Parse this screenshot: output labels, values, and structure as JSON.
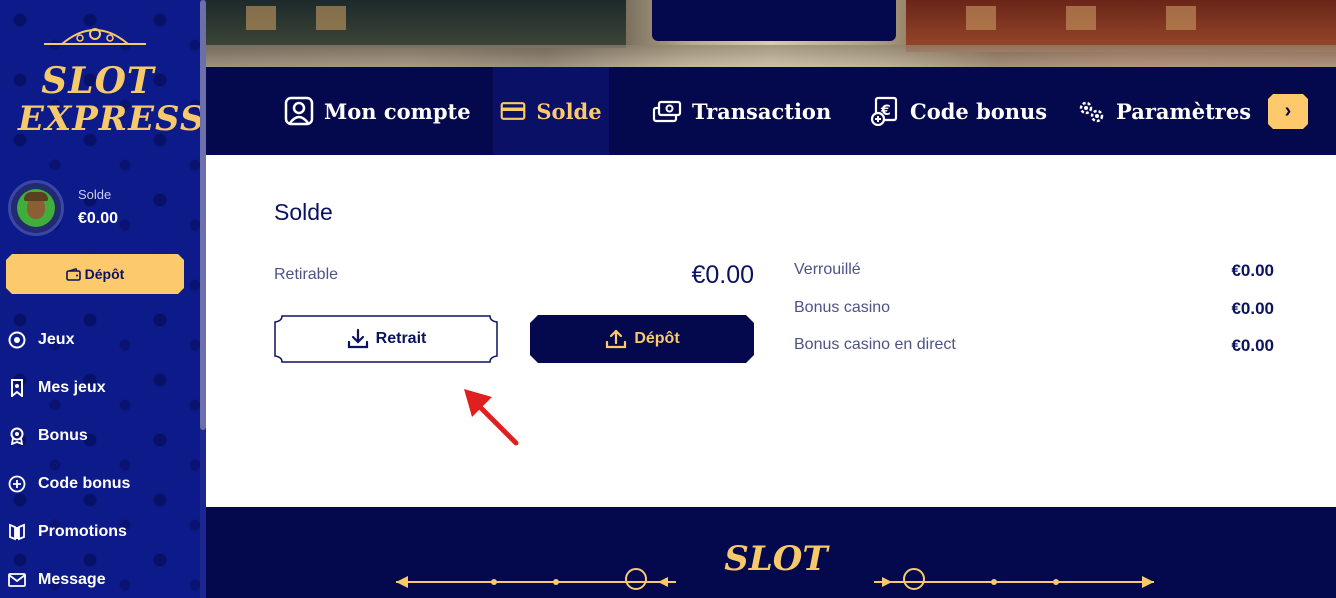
{
  "brand": {
    "line1": "SLOT",
    "line2": "EXPRESS"
  },
  "sidebar": {
    "balance_label": "Solde",
    "balance_value": "€0.00",
    "deposit_label": "Dépôt",
    "items": [
      {
        "label": "Jeux",
        "icon": "poker-chip-icon"
      },
      {
        "label": "Mes jeux",
        "icon": "bookmark-icon"
      },
      {
        "label": "Bonus",
        "icon": "award-icon"
      },
      {
        "label": "Code bonus",
        "icon": "plus-circle-icon"
      },
      {
        "label": "Promotions",
        "icon": "gift-icon"
      },
      {
        "label": "Message",
        "icon": "mail-icon"
      }
    ]
  },
  "tabs": [
    {
      "label": "Mon compte",
      "icon": "user-icon",
      "active": false
    },
    {
      "label": "Solde",
      "icon": "card-icon",
      "active": true
    },
    {
      "label": "Transaction",
      "icon": "cash-icon",
      "active": false
    },
    {
      "label": "Code bonus",
      "icon": "coupon-icon",
      "active": false
    },
    {
      "label": "Paramètres",
      "icon": "gears-icon",
      "active": false
    }
  ],
  "main": {
    "title": "Solde",
    "withdrawable_label": "Retirable",
    "withdrawable_value": "€0.00",
    "withdraw_button": "Retrait",
    "deposit_button": "Dépôt",
    "breakdown": [
      {
        "label": "Verrouillé",
        "value": "€0.00"
      },
      {
        "label": "Bonus casino",
        "value": "€0.00"
      },
      {
        "label": "Bonus casino en direct",
        "value": "€0.00"
      }
    ]
  },
  "colors": {
    "navy": "#04084c",
    "sidebar_blue": "#0d1a8a",
    "gold": "#fcc96c",
    "arrow_red": "#e02020"
  }
}
